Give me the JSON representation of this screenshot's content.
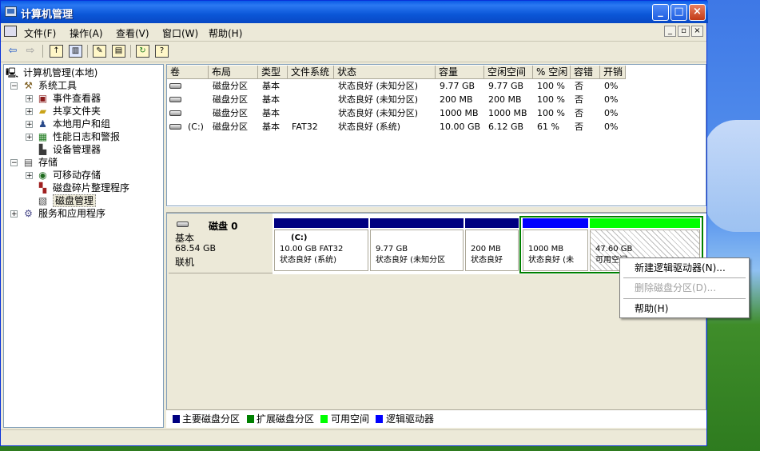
{
  "window": {
    "title": "计算机管理"
  },
  "menu": {
    "items": [
      "文件(F)",
      "操作(A)",
      "查看(V)",
      "窗口(W)",
      "帮助(H)"
    ]
  },
  "tree": {
    "root": "计算机管理(本地)",
    "system_tools": "系统工具",
    "event_viewer": "事件查看器",
    "shared_folders": "共享文件夹",
    "local_users": "本地用户和组",
    "perf_logs": "性能日志和警报",
    "device_manager": "设备管理器",
    "storage": "存储",
    "removable": "可移动存储",
    "defrag": "磁盘碎片整理程序",
    "disk_mgmt": "磁盘管理",
    "services": "服务和应用程序"
  },
  "volume_table": {
    "headers": [
      "卷",
      "布局",
      "类型",
      "文件系统",
      "状态",
      "容量",
      "空闲空间",
      "% 空闲",
      "容错",
      "开销"
    ],
    "rows": [
      [
        "",
        "磁盘分区",
        "基本",
        "",
        "状态良好 (未知分区)",
        "9.77 GB",
        "9.77 GB",
        "100 %",
        "否",
        "0%"
      ],
      [
        "",
        "磁盘分区",
        "基本",
        "",
        "状态良好 (未知分区)",
        "200 MB",
        "200 MB",
        "100 %",
        "否",
        "0%"
      ],
      [
        "",
        "磁盘分区",
        "基本",
        "",
        "状态良好 (未知分区)",
        "1000 MB",
        "1000 MB",
        "100 %",
        "否",
        "0%"
      ],
      [
        "(C:)",
        "磁盘分区",
        "基本",
        "FAT32",
        "状态良好 (系统)",
        "10.00 GB",
        "6.12 GB",
        "61 %",
        "否",
        "0%"
      ]
    ]
  },
  "disk": {
    "name": "磁盘 0",
    "type": "基本",
    "size": "68.54 GB",
    "status": "联机",
    "partitions": [
      {
        "label": "(C:)",
        "size": "10.00 GB FAT32",
        "status": "状态良好 (系统)"
      },
      {
        "label": "",
        "size": "9.77 GB",
        "status": "状态良好 (未知分区"
      },
      {
        "label": "",
        "size": "200 MB",
        "status": "状态良好"
      },
      {
        "label": "",
        "size": "1000 MB",
        "status": "状态良好 (未"
      },
      {
        "label": "",
        "size": "47.60 GB",
        "status": "可用空间"
      }
    ]
  },
  "legend": {
    "items": [
      {
        "label": "主要磁盘分区",
        "color": "#000080"
      },
      {
        "label": "扩展磁盘分区",
        "color": "#008000"
      },
      {
        "label": "可用空间",
        "color": "#00ff00"
      },
      {
        "label": "逻辑驱动器",
        "color": "#0000ff"
      }
    ]
  },
  "context_menu": {
    "new_logical": "新建逻辑驱动器(N)...",
    "delete_partition": "删除磁盘分区(D)...",
    "help": "帮助(H)"
  },
  "colors": {
    "primary": "#000080",
    "extended": "#008000",
    "free": "#00ff00",
    "logical": "#0000ff"
  }
}
